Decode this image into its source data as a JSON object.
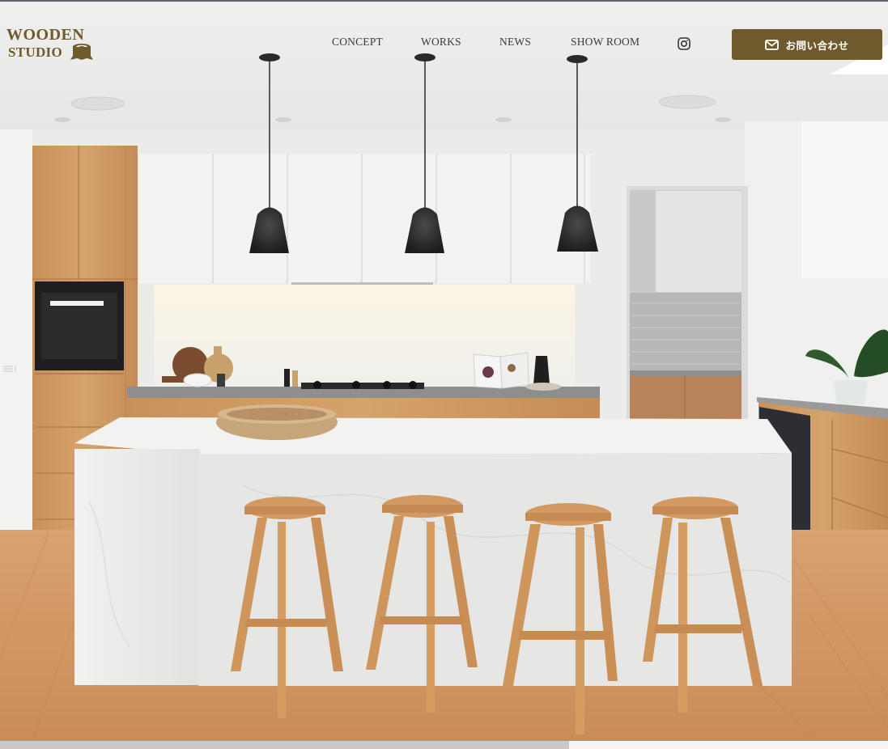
{
  "brand": {
    "logo_line1": "WOODEN",
    "logo_line2": "STUDIO",
    "logo_color": "#6e5a2c"
  },
  "nav": {
    "items": [
      {
        "label": "CONCEPT"
      },
      {
        "label": "WORKS"
      },
      {
        "label": "NEWS"
      },
      {
        "label": "SHOW ROOM"
      }
    ],
    "instagram_icon": "instagram-icon"
  },
  "contact": {
    "label": "お問い合わせ",
    "icon": "envelope-icon",
    "background": "#6e5a2c"
  },
  "hero": {
    "image_subject": "kitchen-photo",
    "palette": {
      "wall": "#ececeb",
      "wood": "#c99763",
      "floor": "#d49a68",
      "counter": "#eeeeec",
      "pendant": "#2c2c2c"
    }
  }
}
